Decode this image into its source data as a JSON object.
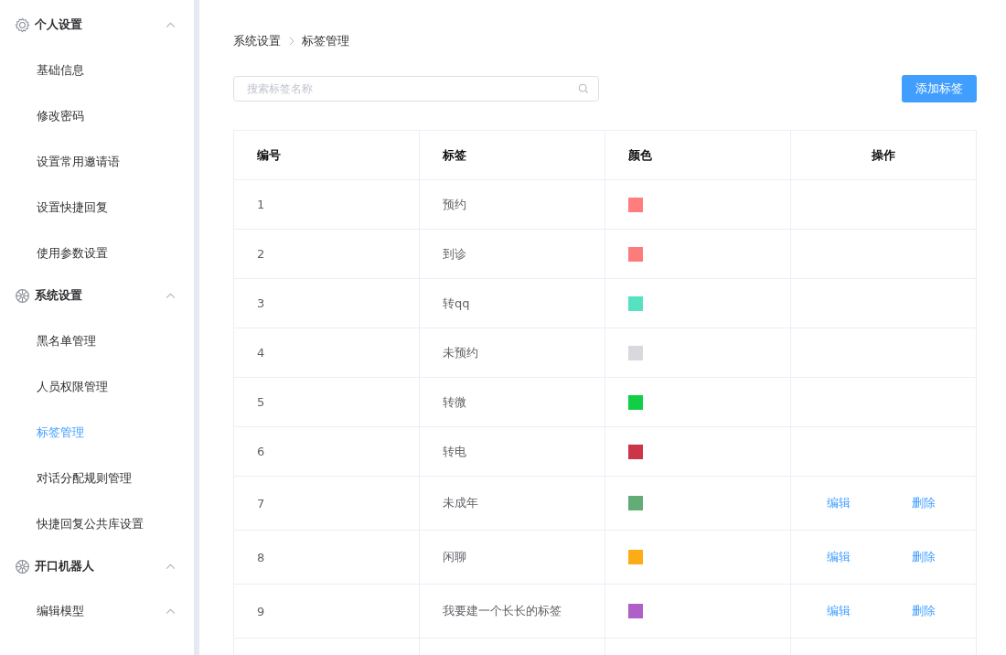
{
  "sidebar": {
    "groups": [
      {
        "label": "个人设置",
        "expanded": true,
        "items": [
          {
            "label": "基础信息",
            "selected": false
          },
          {
            "label": "修改密码",
            "selected": false
          },
          {
            "label": "设置常用邀请语",
            "selected": false
          },
          {
            "label": "设置快捷回复",
            "selected": false
          },
          {
            "label": "使用参数设置",
            "selected": false
          }
        ]
      },
      {
        "label": "系统设置",
        "expanded": true,
        "items": [
          {
            "label": "黑名单管理",
            "selected": false
          },
          {
            "label": "人员权限管理",
            "selected": false
          },
          {
            "label": "标签管理",
            "selected": true
          },
          {
            "label": "对话分配规则管理",
            "selected": false
          },
          {
            "label": "快捷回复公共库设置",
            "selected": false
          }
        ]
      },
      {
        "label": "开口机器人",
        "expanded": true,
        "subgroups": [
          {
            "label": "编辑模型",
            "expanded": true
          }
        ]
      }
    ]
  },
  "breadcrumb": [
    "系统设置",
    "标签管理"
  ],
  "search": {
    "placeholder": "搜索标签名称"
  },
  "add_button": "添加标签",
  "table": {
    "columns": [
      "编号",
      "标签",
      "颜色",
      "操作"
    ],
    "rows": [
      {
        "id": "1",
        "label": "预约",
        "color": "#ff7d7d",
        "actions": []
      },
      {
        "id": "2",
        "label": "到诊",
        "color": "#fc7b7b",
        "actions": []
      },
      {
        "id": "3",
        "label": "转qq",
        "color": "#56e2c0",
        "actions": []
      },
      {
        "id": "4",
        "label": "未预约",
        "color": "#d8d8de",
        "actions": []
      },
      {
        "id": "5",
        "label": "转微",
        "color": "#10cf46",
        "actions": []
      },
      {
        "id": "6",
        "label": "转电",
        "color": "#cc3548",
        "actions": []
      },
      {
        "id": "7",
        "label": "未成年",
        "color": "#62ac76",
        "actions": [
          "编辑",
          "删除"
        ]
      },
      {
        "id": "8",
        "label": "闲聊",
        "color": "#fcad16",
        "actions": [
          "编辑",
          "删除"
        ]
      },
      {
        "id": "9",
        "label": "我要建一个长长的标签",
        "color": "#b05ec8",
        "actions": [
          "编辑",
          "删除"
        ]
      }
    ]
  }
}
